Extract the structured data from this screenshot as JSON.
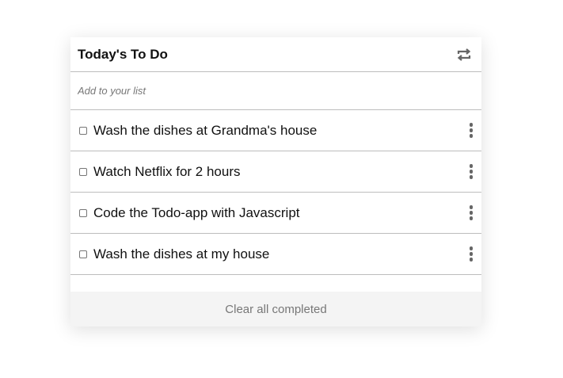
{
  "header": {
    "title": "Today's To Do",
    "refresh_icon": "refresh-icon"
  },
  "add": {
    "placeholder": "Add to your list",
    "value": ""
  },
  "items": [
    {
      "text": "Wash the dishes at Grandma's house",
      "checked": false
    },
    {
      "text": "Watch Netflix for 2 hours",
      "checked": false
    },
    {
      "text": "Code the Todo-app with Javascript",
      "checked": false
    },
    {
      "text": "Wash the dishes at my house",
      "checked": false
    }
  ],
  "footer": {
    "clear_label": "Clear all completed"
  },
  "colors": {
    "border": "#bdbdbd",
    "footer_bg": "#f4f4f4",
    "muted_text": "#777777"
  }
}
